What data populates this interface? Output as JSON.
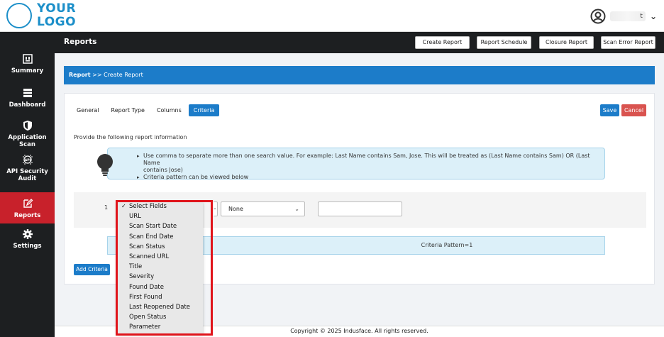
{
  "logo": {
    "line1": "YOUR",
    "line2": "LOGO"
  },
  "user": {
    "name": "t"
  },
  "page": {
    "title": "Reports"
  },
  "top_buttons": [
    "Create Report",
    "Report Schedule",
    "Closure Report",
    "Scan Error Report"
  ],
  "sidebar": {
    "items": [
      {
        "label": "Summary",
        "icon": "summary-icon"
      },
      {
        "label": "Dashboard",
        "icon": "dashboard-icon"
      },
      {
        "label": "Application Scan",
        "icon": "shield-icon"
      },
      {
        "label": "API Security Audit",
        "icon": "api-icon"
      },
      {
        "label": "Reports",
        "icon": "edit-icon",
        "active": true
      },
      {
        "label": "Settings",
        "icon": "gear-icon"
      }
    ]
  },
  "breadcrumb": {
    "root": "Report",
    "separator": " >> ",
    "current": "Create Report"
  },
  "tabs": [
    "General",
    "Report Type",
    "Columns",
    "Criteria"
  ],
  "active_tab": "Criteria",
  "actions": {
    "save": "Save",
    "cancel": "Cancel"
  },
  "info": {
    "heading": "Provide the following report information",
    "hints": [
      "Use comma to separate more than one search value. For example: Last Name contains Sam, Jose. This will be treated as (Last Name contains Sam) OR (Last Name",
      "contains Jose)",
      "Criteria pattern can be viewed below"
    ]
  },
  "criteria_row": {
    "number": "1",
    "operator": "None",
    "value": ""
  },
  "criteria_pattern": "Criteria Pattern=1",
  "add_criteria": "Add Criteria",
  "field_dropdown": {
    "selected": "Select Fields",
    "options": [
      "Select Fields",
      "URL",
      "Scan Start Date",
      "Scan End Date",
      "Scan Status",
      "Scanned URL",
      "Title",
      "Severity",
      "Found Date",
      "First Found",
      "Last Reopened Date",
      "Open Status",
      "Parameter"
    ]
  },
  "footer": "Copyright © 2025 Indusface. All rights reserved.",
  "colors": {
    "accent": "#1c7cc9",
    "danger": "#d9534f",
    "sidebar": "#1d1f21",
    "active_nav": "#c8212b",
    "highlight": "#e0141b"
  }
}
